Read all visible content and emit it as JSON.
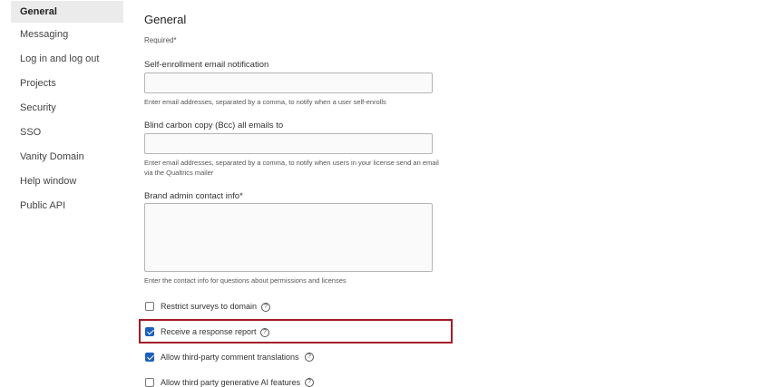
{
  "sidebar": {
    "items": [
      {
        "label": "General",
        "active": true
      },
      {
        "label": "Messaging"
      },
      {
        "label": "Log in and log out"
      },
      {
        "label": "Projects"
      },
      {
        "label": "Security"
      },
      {
        "label": "SSO"
      },
      {
        "label": "Vanity Domain"
      },
      {
        "label": "Help window"
      },
      {
        "label": "Public API"
      }
    ]
  },
  "main": {
    "title": "General",
    "required_note": "Required*",
    "fields": [
      {
        "label": "Self-enrollment email notification",
        "value": "",
        "help": "Enter email addresses, separated by a comma, to notify when a user self-enrolls"
      },
      {
        "label": "Blind carbon copy (Bcc) all emails to",
        "value": "",
        "help": "Enter email addresses, separated by a comma, to notify when users in your license send an email via the Qualtrics mailer"
      },
      {
        "label": "Brand admin contact info*",
        "value": "",
        "help": "Enter the contact info for questions about permissions and licenses"
      }
    ],
    "checkboxes": [
      {
        "label": "Restrict surveys to domain",
        "checked": false
      },
      {
        "label": "Receive a response report",
        "checked": true
      },
      {
        "label": "Allow third-party comment translations",
        "checked": true
      },
      {
        "label": "Allow third party generative AI features",
        "checked": false
      }
    ],
    "info_icon_glyph": "?"
  },
  "colors": {
    "accent": "#1d5fbf",
    "highlight_border": "#a61b29",
    "sidebar_active_bg": "#ebebeb"
  }
}
